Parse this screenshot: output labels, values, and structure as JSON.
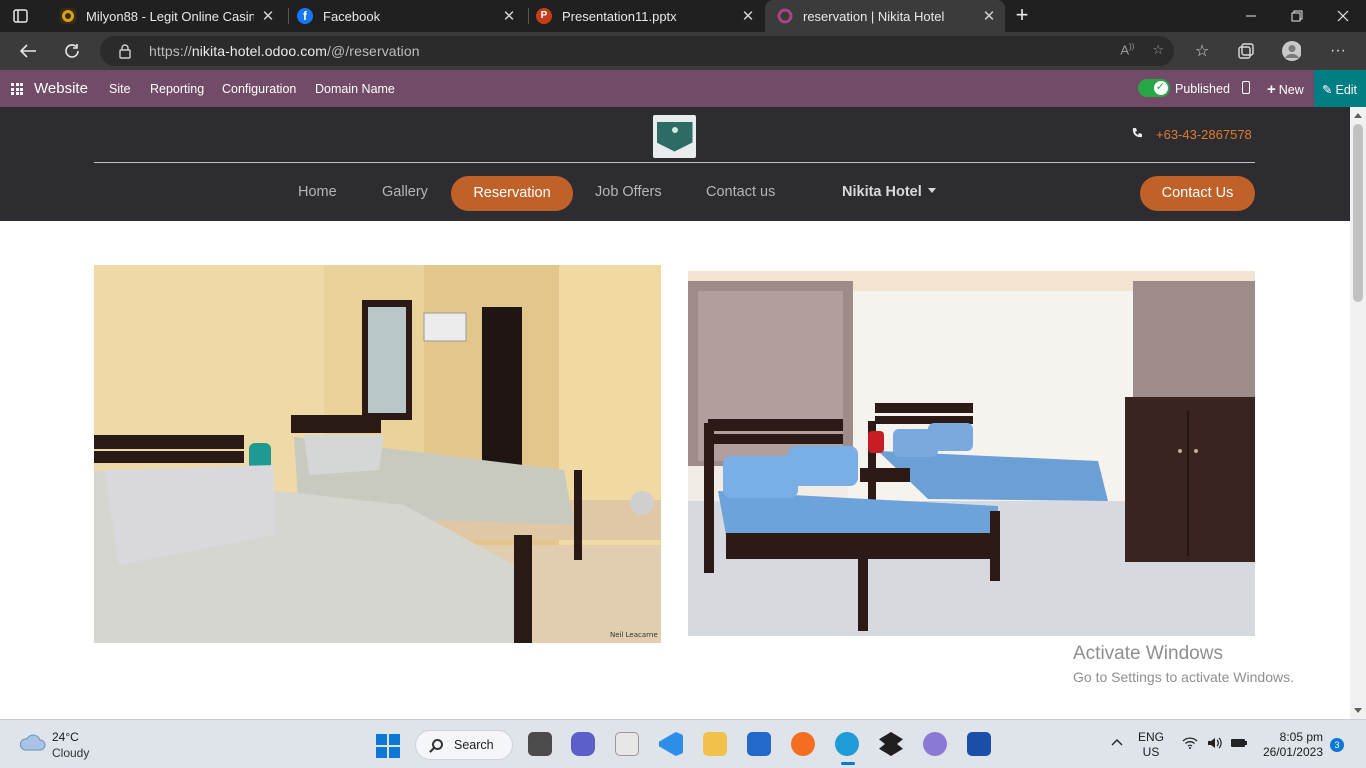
{
  "browser": {
    "tabs": [
      {
        "title": "Milyon88 - Legit Online Casino P",
        "active": false
      },
      {
        "title": "Facebook",
        "active": false
      },
      {
        "title": "Presentation11.pptx",
        "active": false
      },
      {
        "title": "reservation | Nikita Hotel",
        "active": true
      }
    ],
    "close_glyph": "✕",
    "new_tab_glyph": "+",
    "url_prefix": "https://",
    "url_domain": "nikita-hotel.odoo.com",
    "url_path": "/@/reservation"
  },
  "odoo_bar": {
    "app_name": "Website",
    "menu": [
      "Site",
      "Reporting",
      "Configuration",
      "Domain Name"
    ],
    "published_label": "Published",
    "new_label": "New",
    "edit_label": "Edit"
  },
  "site_header": {
    "phone": "+63-43-2867578",
    "nav": [
      "Home",
      "Gallery",
      "Reservation",
      "Job Offers",
      "Contact us"
    ],
    "active_nav": "Reservation",
    "company_dropdown": "Nikita Hotel",
    "cta_label": "Contact Us",
    "accent_color": "#c0612a"
  },
  "photos": [
    {
      "name": "room-photo-1",
      "watermark": "Neil Leacarne"
    },
    {
      "name": "room-photo-2"
    }
  ],
  "windows_watermark": {
    "line1": "Activate Windows",
    "line2": "Go to Settings to activate Windows."
  },
  "taskbar": {
    "weather_temp": "24°C",
    "weather_desc": "Cloudy",
    "search_label": "Search",
    "lang_line1": "ENG",
    "lang_line2": "US",
    "time": "8:05 pm",
    "date": "26/01/2023",
    "notifications": "3"
  }
}
